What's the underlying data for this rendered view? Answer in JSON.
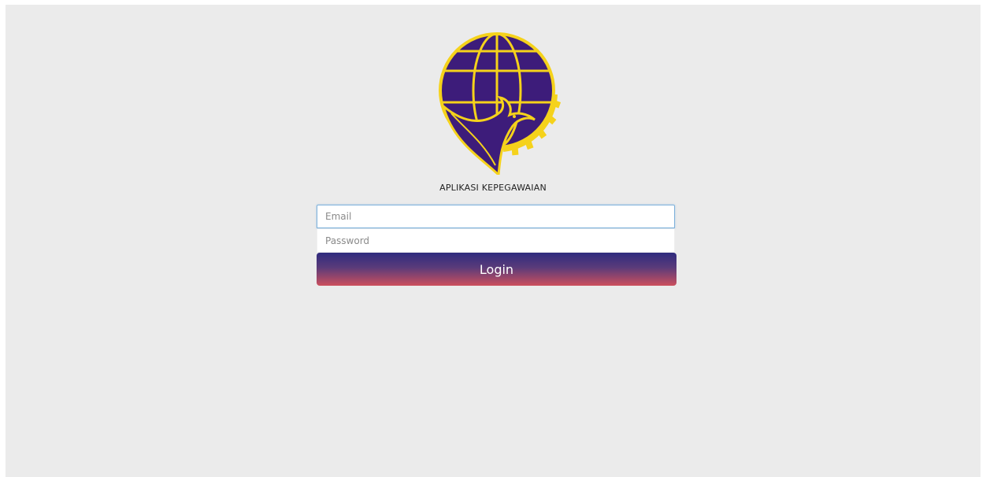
{
  "app": {
    "title": "APLIKASI KEPEGAWAIAN"
  },
  "logo": {
    "icon": "globe-eagle-gear-emblem",
    "colors": {
      "primary": "#3d1c7a",
      "accent": "#f5d21b"
    }
  },
  "form": {
    "email_placeholder": "Email",
    "email_value": "",
    "password_placeholder": "Password",
    "password_value": "",
    "login_label": "Login"
  },
  "theme": {
    "background": "#ebebeb",
    "button_gradient_top": "#2f2b7e",
    "button_gradient_bottom": "#cc4f5d"
  }
}
